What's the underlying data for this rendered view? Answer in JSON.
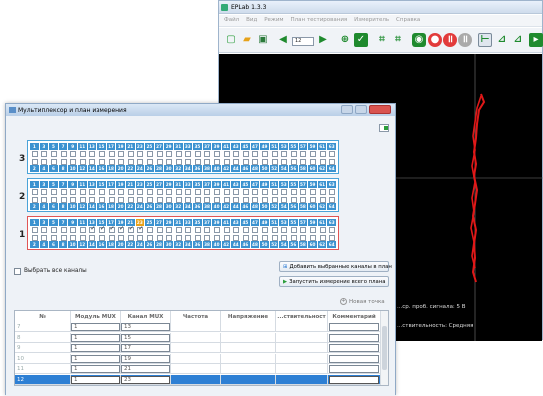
{
  "eplab": {
    "title": "EPLab 1.3.3",
    "menu": [
      "Файл",
      "Вид",
      "Режим",
      "План тестирования",
      "Измеритель",
      "Справка"
    ],
    "toolbar_value": "12",
    "status_signal": "...ср. проб. сигнала: 5 В",
    "status_sensitivity": "...ствительность: Средняя"
  },
  "mux": {
    "title": "Мультиплексор и план измерения",
    "rows": [
      {
        "label": "3",
        "nums_top": [
          "1",
          "3",
          "5",
          "7",
          "9",
          "11",
          "13",
          "15",
          "17",
          "19",
          "21",
          "23",
          "25",
          "27",
          "29",
          "31",
          "33",
          "35",
          "37",
          "39",
          "41",
          "43",
          "45",
          "47",
          "49",
          "51",
          "53",
          "55",
          "57",
          "59",
          "61",
          "63"
        ],
        "nums_bottom": [
          "2",
          "4",
          "6",
          "8",
          "10",
          "12",
          "14",
          "16",
          "18",
          "20",
          "22",
          "24",
          "26",
          "28",
          "30",
          "32",
          "34",
          "36",
          "38",
          "40",
          "42",
          "44",
          "46",
          "48",
          "50",
          "52",
          "54",
          "56",
          "58",
          "60",
          "62",
          "64"
        ]
      },
      {
        "label": "2",
        "nums_top": [
          "1",
          "3",
          "5",
          "7",
          "9",
          "11",
          "13",
          "15",
          "17",
          "19",
          "21",
          "23",
          "25",
          "27",
          "29",
          "31",
          "33",
          "35",
          "37",
          "39",
          "41",
          "43",
          "45",
          "47",
          "49",
          "51",
          "53",
          "55",
          "57",
          "59",
          "61",
          "63"
        ],
        "nums_bottom": [
          "2",
          "4",
          "6",
          "8",
          "10",
          "12",
          "14",
          "16",
          "18",
          "20",
          "22",
          "24",
          "26",
          "28",
          "30",
          "32",
          "34",
          "36",
          "38",
          "40",
          "42",
          "44",
          "46",
          "48",
          "50",
          "52",
          "54",
          "56",
          "58",
          "60",
          "62",
          "64"
        ]
      },
      {
        "label": "1",
        "nums_top": [
          "1",
          "3",
          "5",
          "7",
          "9",
          "11",
          "13",
          "15",
          "17",
          "19",
          "21",
          "23",
          "25",
          "27",
          "29",
          "31",
          "33",
          "35",
          "37",
          "39",
          "41",
          "43",
          "45",
          "47",
          "49",
          "51",
          "53",
          "55",
          "57",
          "59",
          "61",
          "63"
        ],
        "nums_bottom": [
          "2",
          "4",
          "6",
          "8",
          "10",
          "12",
          "14",
          "16",
          "18",
          "20",
          "22",
          "24",
          "26",
          "28",
          "30",
          "32",
          "34",
          "36",
          "38",
          "40",
          "42",
          "44",
          "46",
          "48",
          "50",
          "52",
          "54",
          "56",
          "58",
          "60",
          "62",
          "64"
        ]
      }
    ],
    "select_all_label": "Выбрать все каналы",
    "add_button": "Добавить выбранные каналы в план",
    "run_button": "Запустить измерение всего плана",
    "new_point": "Новая точка",
    "table": {
      "headers": [
        "№",
        "Модуль MUX",
        "Канал MUX",
        "Частота",
        "Напряжение",
        "...ствительност",
        "Комментарий"
      ],
      "rows": [
        {
          "n": "7",
          "module": "1",
          "channel": "13"
        },
        {
          "n": "8",
          "module": "1",
          "channel": "15"
        },
        {
          "n": "9",
          "module": "1",
          "channel": "17"
        },
        {
          "n": "10",
          "module": "1",
          "channel": "19"
        },
        {
          "n": "11",
          "module": "1",
          "channel": "21"
        },
        {
          "n": "12",
          "module": "1",
          "channel": "23"
        }
      ]
    }
  }
}
